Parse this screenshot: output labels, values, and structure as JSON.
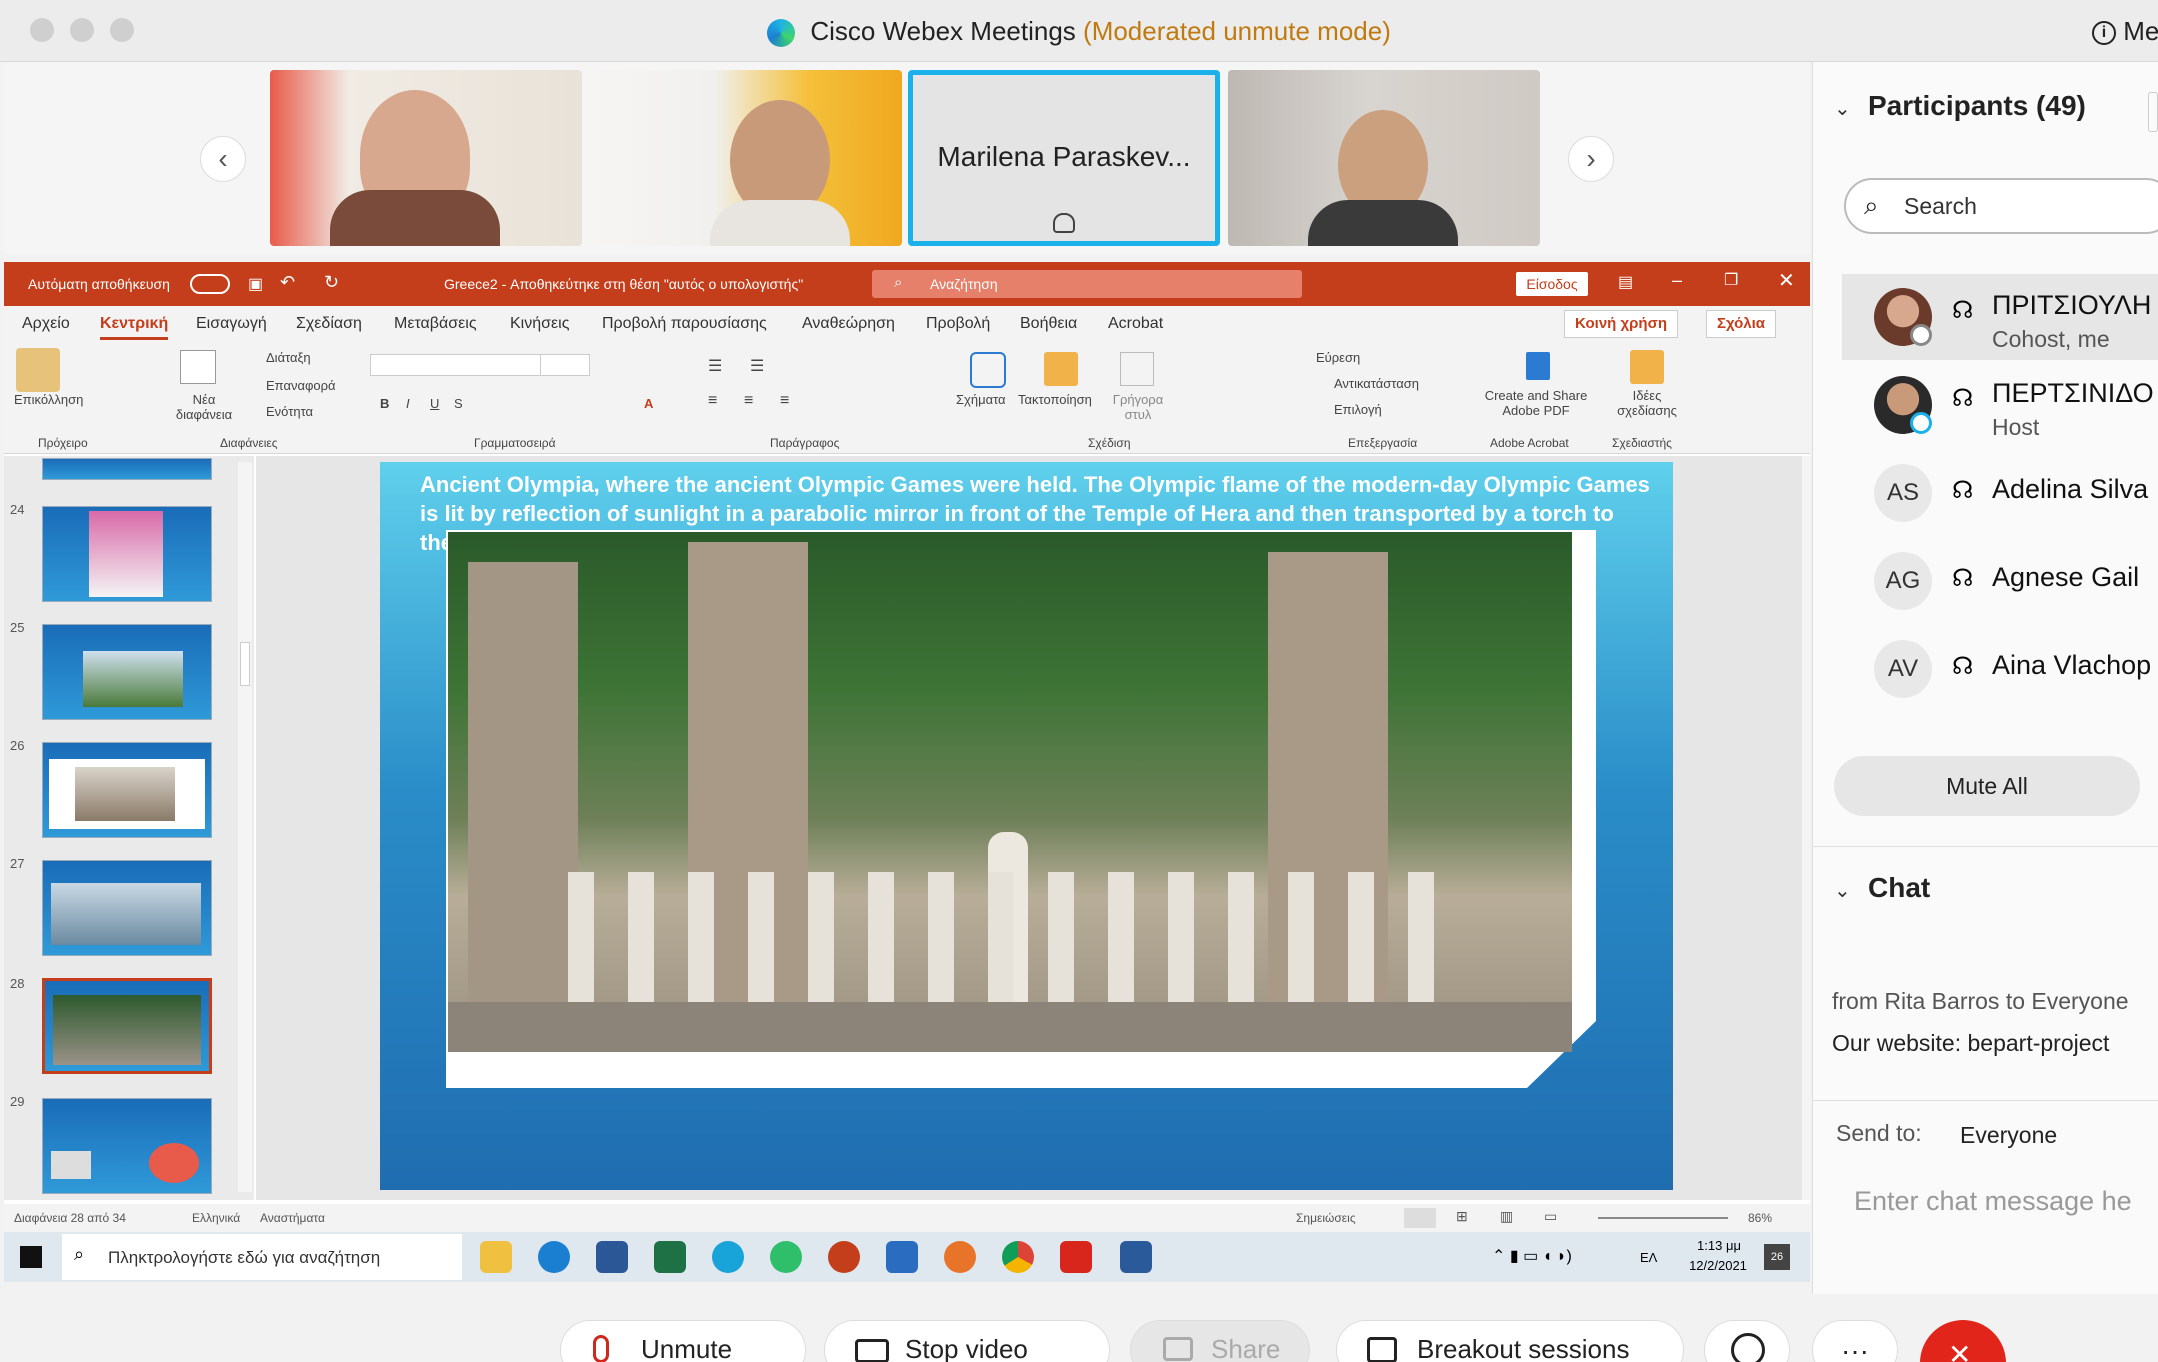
{
  "window": {
    "title": "Cisco Webex Meetings",
    "mode": "(Moderated unmute mode)",
    "meeting_info": "Me"
  },
  "tiles": {
    "name_tile": "Marilena Paraskev..."
  },
  "ppt": {
    "autosave": "Αυτόματη αποθήκευση",
    "filename": "Greece2 - Αποθηκεύτηκε στη θέση \"αυτός ο υπολογιστής\"",
    "search": "Αναζήτηση",
    "signin": "Είσοδος",
    "menu": [
      "Αρχείο",
      "Κεντρική",
      "Εισαγωγή",
      "Σχεδίαση",
      "Μεταβάσεις",
      "Κινήσεις",
      "Προβολή παρουσίασης",
      "Αναθεώρηση",
      "Προβολή",
      "Βοήθεια",
      "Acrobat"
    ],
    "share": "Κοινή χρήση",
    "comments": "Σχόλια",
    "ribbon_groups": [
      "Πρόχειρο",
      "Διαφάνειες",
      "Γραμματοσειρά",
      "Παράγραφος",
      "Σχέδιση",
      "Επεξεργασία",
      "Adobe Acrobat",
      "Σχεδιαστής"
    ],
    "ribbon_labels": {
      "paste": "Επικόλληση",
      "new_slide": "Νέα διαφάνεια",
      "layout": "Διάταξη",
      "reset": "Επαναφορά",
      "section": "Ενότητα",
      "shapes": "Σχήματα",
      "arrange": "Τακτοποίηση",
      "quick_styles": "Γρήγορα στυλ",
      "find": "Εύρεση",
      "replace": "Αντικατάσταση",
      "select": "Επιλογή",
      "adobe": "Create and Share Adobe PDF",
      "ideas": "Ιδέες σχεδίασης"
    },
    "thumb_numbers": [
      "24",
      "25",
      "26",
      "27",
      "28",
      "29"
    ],
    "slide_text": "Ancient Olympia, where the ancient Olympic Games were held. The Olympic flame of the modern-day Olympic Games is lit by reflection of sunlight in a parabolic mirror in front of the Temple of Hera and then transported by a torch to the place where the Games are held.",
    "status_left": "Διαφάνεια 28 από 34",
    "status_lang": "Ελληνικά",
    "status_access": "Αναστήματα",
    "status_notes": "Σημειώσεις",
    "zoom": "86%"
  },
  "taskbar": {
    "search_placeholder": "Πληκτρολογήστε εδώ για αναζήτηση",
    "lang": "ΕΛ",
    "time": "1:13 μμ",
    "date": "12/2/2021",
    "notif": "26"
  },
  "controls": {
    "unmute": "Unmute",
    "stop_video": "Stop video",
    "share": "Share",
    "breakout": "Breakout sessions"
  },
  "participants": {
    "header": "Participants (49)",
    "search_placeholder": "Search",
    "list": [
      {
        "initials": "",
        "name": "ΠΡΙΤΣΙΟΥΛΗ",
        "role": "Cohost, me"
      },
      {
        "initials": "",
        "name": "ΠΕΡΤΣΙΝΙΔΟ",
        "role": "Host"
      },
      {
        "initials": "AS",
        "name": "Adelina Silva",
        "role": ""
      },
      {
        "initials": "AG",
        "name": "Agnese Gail",
        "role": ""
      },
      {
        "initials": "AV",
        "name": "Aina Vlachop",
        "role": ""
      }
    ],
    "mute_all": "Mute All"
  },
  "chat": {
    "header": "Chat",
    "from": "from Rita Barros to Everyone",
    "message": "Our website: bepart-project",
    "send_to_label": "Send to:",
    "send_to_value": "Everyone",
    "input_placeholder": "Enter chat message he"
  }
}
